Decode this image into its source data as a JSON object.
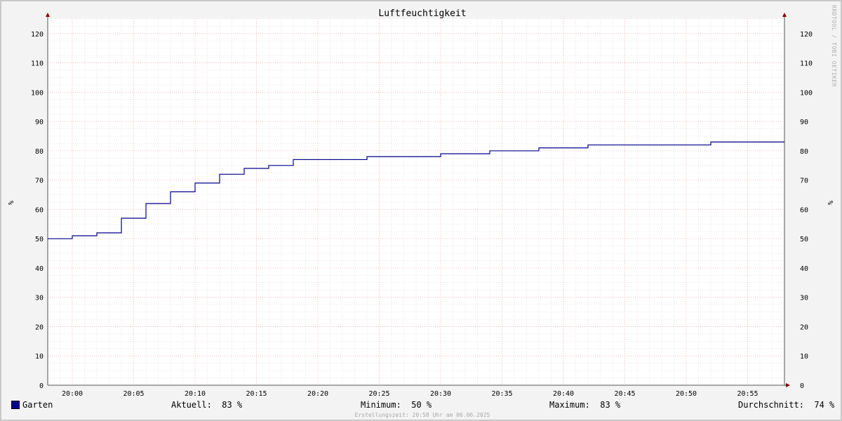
{
  "title": "Luftfeuchtigkeit",
  "watermark": "RRDTOOL / TOBI OETIKER",
  "footer": "Erstellungszeit: 20:58 Uhr am 06.06.2025",
  "legend": {
    "series_name": "Garten",
    "color": "#00008b",
    "aktuell": "Aktuell:  83 %",
    "minimum": "Minimum:  50 %",
    "maximum": "Maximum:  83 %",
    "durchschnitt": "Durchschnitt:  74 %"
  },
  "chart_data": {
    "type": "line",
    "title": "Luftfeuchtigkeit",
    "ylabel": "%",
    "ylabel_right": "%",
    "xlabel": "",
    "x_start": "19:58",
    "x_end": "20:58",
    "ylim": [
      0,
      125
    ],
    "y_ticks": [
      0,
      10,
      20,
      30,
      40,
      50,
      60,
      70,
      80,
      90,
      100,
      110,
      120
    ],
    "x_ticks": [
      "20:00",
      "20:05",
      "20:10",
      "20:15",
      "20:20",
      "20:25",
      "20:30",
      "20:35",
      "20:40",
      "20:45",
      "20:50",
      "20:55"
    ],
    "grid": true,
    "legend_position": "bottom",
    "series": [
      {
        "name": "Garten",
        "color": "#00008b",
        "step": true,
        "points": [
          [
            "19:58",
            50
          ],
          [
            "20:00",
            51
          ],
          [
            "20:02",
            52
          ],
          [
            "20:04",
            57
          ],
          [
            "20:06",
            62
          ],
          [
            "20:08",
            66
          ],
          [
            "20:10",
            69
          ],
          [
            "20:12",
            72
          ],
          [
            "20:14",
            74
          ],
          [
            "20:16",
            75
          ],
          [
            "20:18",
            77
          ],
          [
            "20:24",
            78
          ],
          [
            "20:30",
            79
          ],
          [
            "20:34",
            80
          ],
          [
            "20:38",
            81
          ],
          [
            "20:42",
            82
          ],
          [
            "20:52",
            83
          ],
          [
            "20:58",
            83
          ]
        ]
      }
    ]
  }
}
